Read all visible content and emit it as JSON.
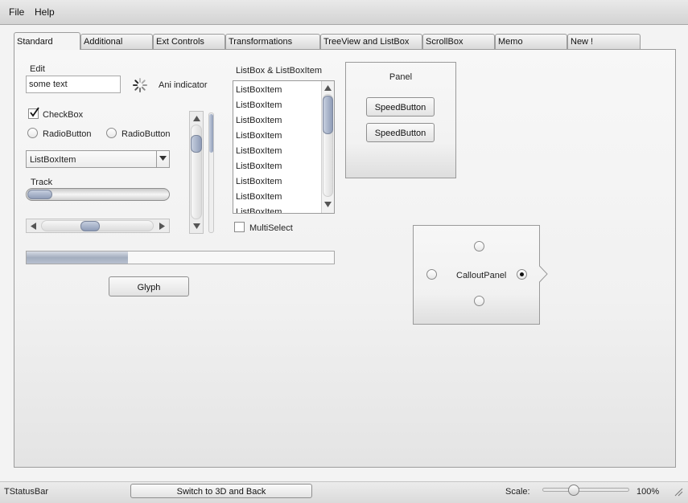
{
  "menu": {
    "file": "File",
    "help": "Help"
  },
  "tabs": [
    {
      "label": "Standard",
      "active": true
    },
    {
      "label": "Additional"
    },
    {
      "label": "Ext Controls"
    },
    {
      "label": "Transformations"
    },
    {
      "label": "TreeView and ListBox"
    },
    {
      "label": "ScrollBox"
    },
    {
      "label": "Memo"
    },
    {
      "label": "New !"
    }
  ],
  "standard": {
    "edit_label": "Edit",
    "edit_value": "some text",
    "ani_label": "Ani indicator",
    "checkbox_label": "CheckBox",
    "checkbox_checked": true,
    "radio1_label": "RadioButton",
    "radio2_label": "RadioButton",
    "combo_value": "ListBoxItem",
    "track_label": "Track",
    "track_fraction": 0.0,
    "hscroll_fraction": 0.42,
    "vscroll_fraction": 0.12,
    "listbox_label": "ListBox & ListBoxItem",
    "listbox_items": [
      "ListBoxItem",
      "ListBoxItem",
      "ListBoxItem",
      "ListBoxItem",
      "ListBoxItem",
      "ListBoxItem",
      "ListBoxItem",
      "ListBoxItem",
      "ListBoxItem"
    ],
    "multiselect_label": "MultiSelect",
    "panel_label": "Panel",
    "speed1": "SpeedButton",
    "speed2": "SpeedButton",
    "progress_fraction": 0.33,
    "glyph_label": "Glyph",
    "callout_label": "CalloutPanel"
  },
  "status": {
    "text": "TStatusBar",
    "switch_label": "Switch to 3D and Back",
    "scale_label": "Scale:",
    "scale_value": "100%",
    "scale_fraction": 0.34
  }
}
